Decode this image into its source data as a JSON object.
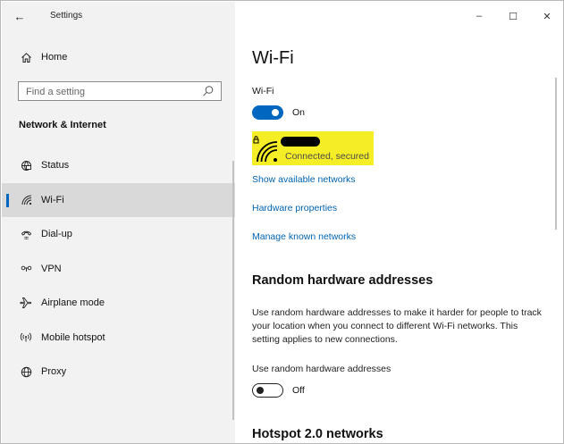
{
  "window": {
    "title": "Settings",
    "back_glyph": "←",
    "controls": {
      "minimize": "–",
      "maximize": "☐",
      "close": "✕"
    }
  },
  "sidebar": {
    "home_label": "Home",
    "search_placeholder": "Find a setting",
    "section_title": "Network & Internet",
    "items": [
      {
        "label": "Status",
        "icon": "globe-status-icon",
        "selected": false
      },
      {
        "label": "Wi-Fi",
        "icon": "wifi-icon",
        "selected": true
      },
      {
        "label": "Dial-up",
        "icon": "dialup-icon",
        "selected": false
      },
      {
        "label": "VPN",
        "icon": "vpn-icon",
        "selected": false
      },
      {
        "label": "Airplane mode",
        "icon": "airplane-icon",
        "selected": false
      },
      {
        "label": "Mobile hotspot",
        "icon": "hotspot-icon",
        "selected": false
      },
      {
        "label": "Proxy",
        "icon": "globe-icon",
        "selected": false
      }
    ]
  },
  "main": {
    "title": "Wi-Fi",
    "wifi_label": "Wi-Fi",
    "wifi_toggle": {
      "state": "On",
      "on": true
    },
    "network": {
      "status": "Connected, secured",
      "icon": "wifi-secured-icon"
    },
    "links": {
      "show_networks": "Show available networks",
      "hardware_properties": "Hardware properties",
      "manage_networks": "Manage known networks"
    },
    "random_hw": {
      "heading": "Random hardware addresses",
      "description": "Use random hardware addresses to make it harder for people to track your location when you connect to different Wi-Fi networks. This setting applies to new connections.",
      "setting_label": "Use random hardware addresses",
      "toggle": {
        "state": "Off",
        "on": false
      }
    },
    "hotspot_heading": "Hotspot 2.0 networks"
  },
  "colors": {
    "accent": "#0067c0",
    "link": "#0063b1",
    "highlight": "#f5ee26",
    "sidebar_bg": "#f2f2f2",
    "selected_bg": "#d9d9d9"
  }
}
